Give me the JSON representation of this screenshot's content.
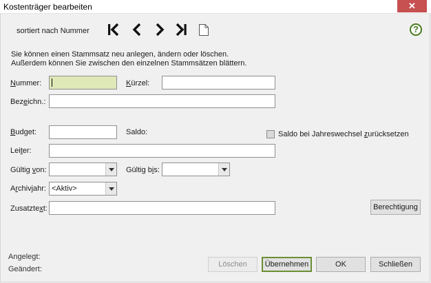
{
  "window": {
    "title": "Kostenträger bearbeiten",
    "close_symbol": "✕"
  },
  "toolbar": {
    "sort_label": "sortiert nach Nummer",
    "icons": [
      "first-record-icon",
      "previous-record-icon",
      "next-record-icon",
      "last-record-icon",
      "new-document-icon"
    ],
    "help_symbol": "?"
  },
  "info": {
    "line1": "Sie können einen Stammsatz neu anlegen, ändern oder löschen.",
    "line2": "Außerdem können Sie zwischen den einzelnen Stammsätzen blättern."
  },
  "form": {
    "nummer": {
      "label_a": "N",
      "label_b": "ummer:",
      "value": ""
    },
    "kuerzel": {
      "label_a": "K",
      "label_b": "ürzel:",
      "value": ""
    },
    "bezeichnung": {
      "label_a": "Bez",
      "label_u": "e",
      "label_b": "ichn.:",
      "value": ""
    },
    "budget": {
      "label_a": "B",
      "label_b": "udget:",
      "value": ""
    },
    "saldo": {
      "label": "Saldo:"
    },
    "saldo_reset": {
      "label_a": "Saldo bei Jahreswechsel ",
      "label_u": "z",
      "label_b": "urücksetzen",
      "checked": false
    },
    "leiter": {
      "label_a": "Lei",
      "label_u": "t",
      "label_b": "er:",
      "value": ""
    },
    "gueltig_von": {
      "label_a": "Gültig ",
      "label_u": "v",
      "label_b": "on:",
      "value": ""
    },
    "gueltig_bis": {
      "label_a": "Gültig b",
      "label_u": "i",
      "label_b": "s:",
      "value": ""
    },
    "archivjahr": {
      "label_a": "A",
      "label_u": "r",
      "label_b": "chivjahr:",
      "value": "<Aktiv>"
    },
    "zusatztext": {
      "label_a": "Zusatzte",
      "label_u": "x",
      "label_b": "t:",
      "value": ""
    }
  },
  "buttons": {
    "berechtigung": "Berechtigung",
    "loeschen_u": "L",
    "loeschen_b": "öschen",
    "uebernehmen_u": "Ü",
    "uebernehmen_b": "bernehmen",
    "ok_u": "O",
    "ok_b": "K",
    "schliessen_a": "Schlie",
    "schliessen_u": "ß",
    "schliessen_b": "en"
  },
  "footer": {
    "angelegt": "Angelegt:",
    "geaendert": "Geändert:"
  },
  "colors": {
    "focused_field": "#dfe9b8",
    "primary_border": "#6a8e33",
    "help_green": "#4a7a1e",
    "close_red": "#c75050"
  }
}
